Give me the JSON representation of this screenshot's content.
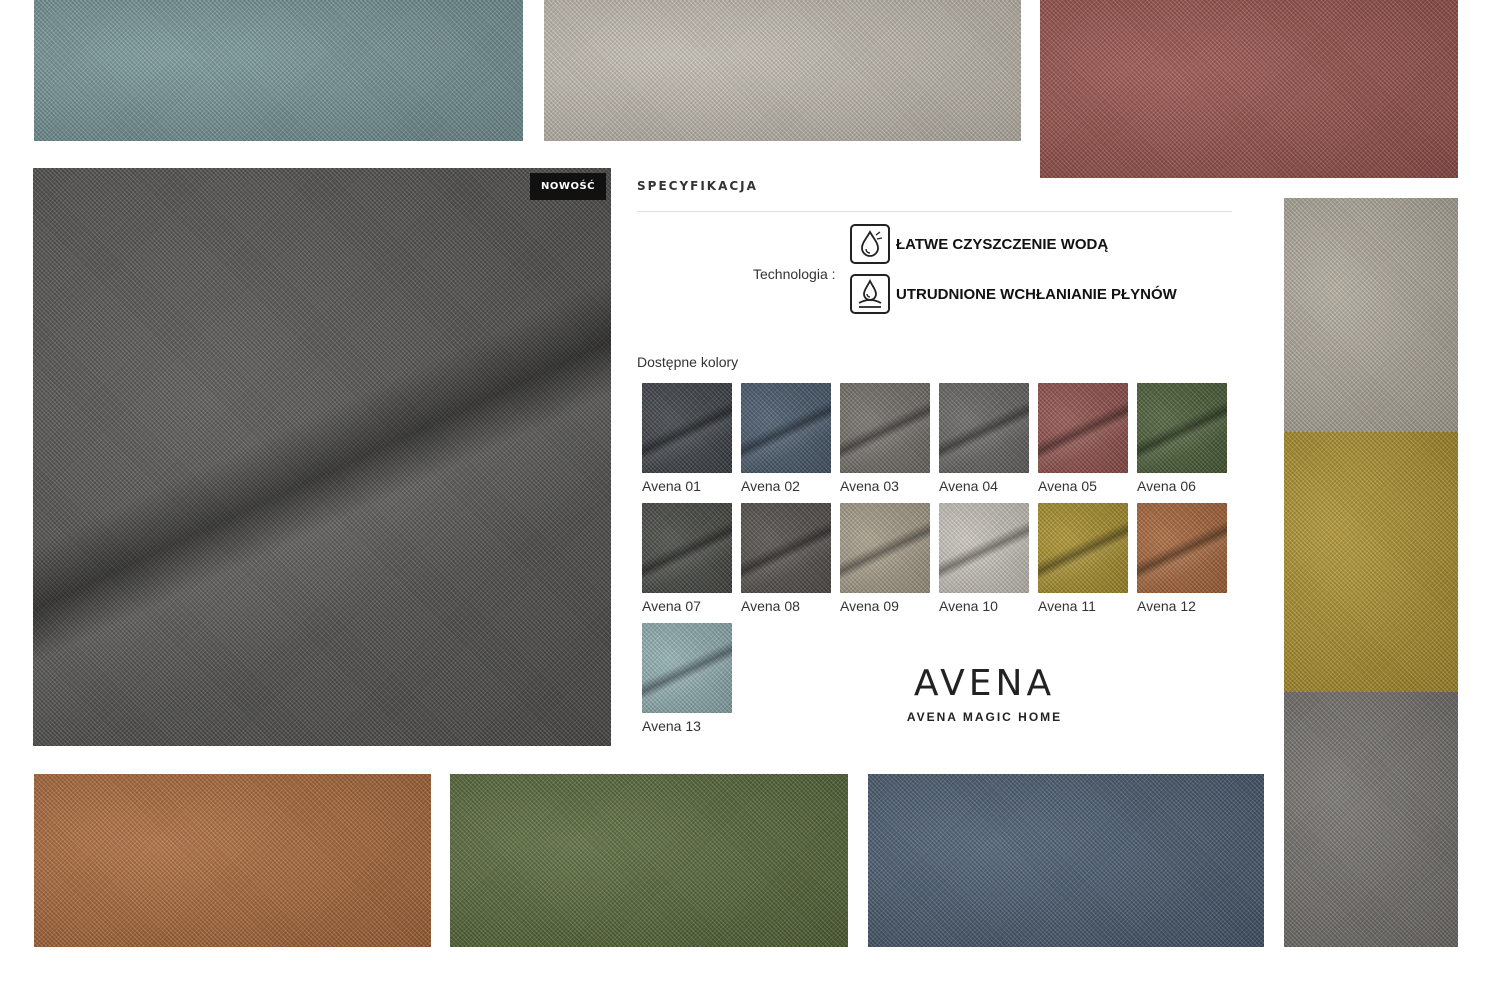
{
  "badge": {
    "label": "NOWOŚĆ"
  },
  "spec": {
    "title": "SPECYFIKACJA",
    "technology_label": "Technologia :",
    "technologies": [
      {
        "icon": "water-drop-clean-icon",
        "label": "ŁATWE CZYSZCZENIE WODĄ"
      },
      {
        "icon": "liquid-repellent-icon",
        "label": "UTRUDNIONE WCHŁANIANIE PŁYNÓW"
      }
    ],
    "colors_label": "Dostępne kolory",
    "colors": [
      {
        "name": "Avena 01",
        "color": "#3f444a"
      },
      {
        "name": "Avena 02",
        "color": "#4b5e72"
      },
      {
        "name": "Avena 03",
        "color": "#7a7670"
      },
      {
        "name": "Avena 04",
        "color": "#6c6b68"
      },
      {
        "name": "Avena 05",
        "color": "#9c5550"
      },
      {
        "name": "Avena 06",
        "color": "#4d6338"
      },
      {
        "name": "Avena 07",
        "color": "#4a4c46"
      },
      {
        "name": "Avena 08",
        "color": "#57534f"
      },
      {
        "name": "Avena 09",
        "color": "#b2a892"
      },
      {
        "name": "Avena 10",
        "color": "#d9d4ca"
      },
      {
        "name": "Avena 11",
        "color": "#b59a2c"
      },
      {
        "name": "Avena 12",
        "color": "#b46c3c"
      },
      {
        "name": "Avena 13",
        "color": "#9bbcbf"
      }
    ]
  },
  "brand": {
    "name": "AVENA",
    "subtitle": "AVENA MAGIC HOME"
  },
  "tiles": {
    "top_1": "#7fa0a3",
    "top_2": "#d2cbbf",
    "top_3": "#a35650",
    "right_1": "#bdb6a7",
    "right_2": "#b99b2f",
    "right_3": "#7b7873",
    "bottom_1": "#b8703d",
    "bottom_2": "#5d6f3c",
    "bottom_3": "#4c6076",
    "main": "#575654"
  }
}
